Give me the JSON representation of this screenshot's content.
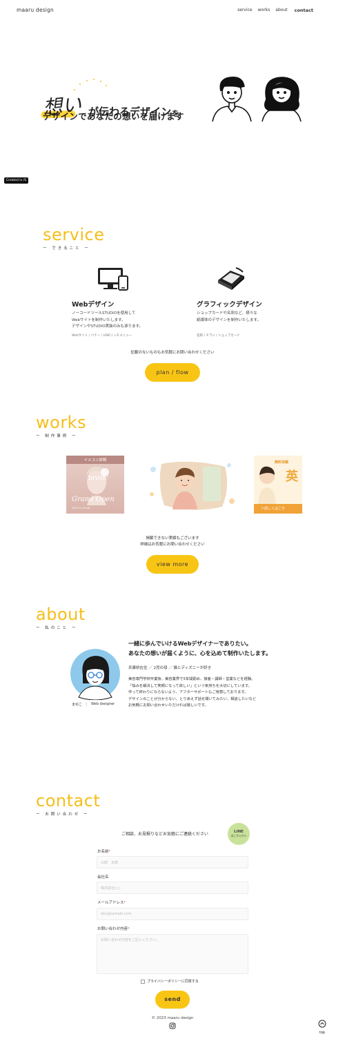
{
  "header": {
    "logo": "maaru design",
    "nav": [
      "service",
      "works",
      "about",
      "contact"
    ]
  },
  "hero": {
    "omoi": "想い",
    "line1_a": "が伝わるデザイン",
    "line1_b": "を",
    "line2": "デザインであなたの想いを届けます"
  },
  "created_badge": "Created in /S",
  "service": {
    "title": "service",
    "subtitle": "ー できること ー",
    "items": [
      {
        "name": "Webデザイン",
        "desc1": "ノーコードツールSTUDIOを使用して",
        "desc2": "Webサイトを制作いたします。",
        "desc3": "デザインやSTUDIO実装のみも承ります。",
        "tags": "Webサイト / バナー / LINEリッチメニュー",
        "icon": "monitor-phone-icon"
      },
      {
        "name": "グラフィックデザイン",
        "desc1": "ショップカードや名刺など、様々な",
        "desc2": "紙媒体のデザインを制作いたします。",
        "desc3": "",
        "tags": "名刺 / チラシ / ショップカード",
        "icon": "paper-stack-icon"
      }
    ],
    "note": "記載のないものもお気軽にお問い合わせください",
    "button": "plan / flow"
  },
  "works": {
    "title": "works",
    "subtitle": "ー 制作事例 ー",
    "cards": [
      {
        "banner": "イメコン診断",
        "brand": "brush",
        "headline": "Grand Open",
        "date": "2023.11.20 sat"
      },
      {
        "caption": ""
      },
      {
        "badge": "無料体験",
        "big": "英",
        "cta": "＞詳しくはこち"
      }
    ],
    "note1": "掲載できない実績もございます",
    "note2": "詳細はお気軽にお問い合わせください",
    "button": "view more"
  },
  "about": {
    "title": "about",
    "subtitle": "ー 私のこと ー",
    "lead1": "一緒に歩んでいけるWebデザイナーでありたい。",
    "lead2": "あなたの想いが届くように、心を込めて制作いたします。",
    "meta": "兵庫県在住 ／ 2児の母 ／ 猫とディズニーが好き",
    "body": [
      "美容専門学校卒業後、美容業界で5年間勤め、接客・講師・営業などを経験。",
      "「悩みを解決して笑顔になって欲しい」という気持ちを大切にしています。",
      "作って終わりにならないよう、アフターサポートもご用意しております。",
      "デザインのことが分からない、とりあえず話を聞いてみたい、相談したいなど",
      "お気軽にお問い合わせいただければ嬉しいです。"
    ],
    "name": "まゆこ",
    "sep": "｜",
    "role": "Web designer"
  },
  "contact": {
    "title": "contact",
    "subtitle": "ー お問い合わせ ー",
    "intro": "ご相談、お見積りなどお気軽にご連絡ください",
    "line_label": "LINE",
    "line_sub": "はこちらから",
    "fields": [
      {
        "label": "お名前",
        "required": "*",
        "placeholder": "山田　太郎"
      },
      {
        "label": "会社名",
        "required": "",
        "placeholder": "株式会社○○"
      },
      {
        "label": "メールアドレス",
        "required": "*",
        "placeholder": "abc@sample.com"
      },
      {
        "label": "お問い合わせ内容",
        "required": "*",
        "placeholder": "お問い合わせ内容をご記入ください。"
      }
    ],
    "privacy": "プライバシーポリシーに同意する",
    "submit": "send"
  },
  "footer": {
    "copyright": "© 2023 maaru design",
    "top": "top"
  },
  "colors": {
    "accent": "#f9c515",
    "title": "#f5be1b",
    "line_badge": "#c9e29a",
    "avatar_bg": "#8ec9ec"
  }
}
